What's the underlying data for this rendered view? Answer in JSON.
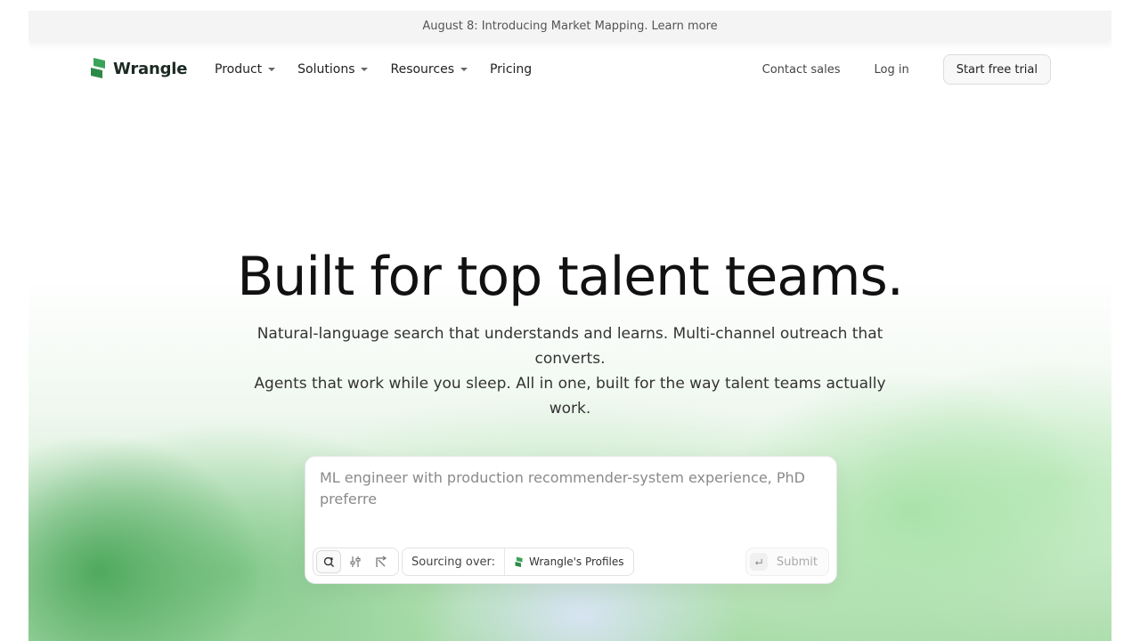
{
  "announcement": {
    "text": "August 8: Introducing Market Mapping.",
    "link": "Learn more"
  },
  "nav": {
    "brand": "Wrangle",
    "menu": [
      {
        "label": "Product",
        "has_dropdown": true
      },
      {
        "label": "Solutions",
        "has_dropdown": true
      },
      {
        "label": "Resources",
        "has_dropdown": true
      },
      {
        "label": "Pricing",
        "has_dropdown": false
      }
    ],
    "contact_sales": "Contact sales",
    "log_in": "Log in",
    "start_trial": "Start free trial"
  },
  "hero": {
    "title": "Built for top talent teams.",
    "subtitle_line1": "Natural-language search that understands and learns. Multi-channel outreach that converts.",
    "subtitle_line2": "Agents that work while you sleep. All in one, built for the way talent teams actually work."
  },
  "search": {
    "query": "ML engineer with production recommender-system experience, PhD preferre",
    "tools": [
      "search-tool",
      "filter-tool",
      "branch-tool"
    ],
    "sourcing_label": "Sourcing over:",
    "source": "Wrangle's Profiles",
    "submit_label": "Submit"
  },
  "colors": {
    "brand_green": "#3aa35a",
    "brand_green_dark": "#2c8a48"
  }
}
